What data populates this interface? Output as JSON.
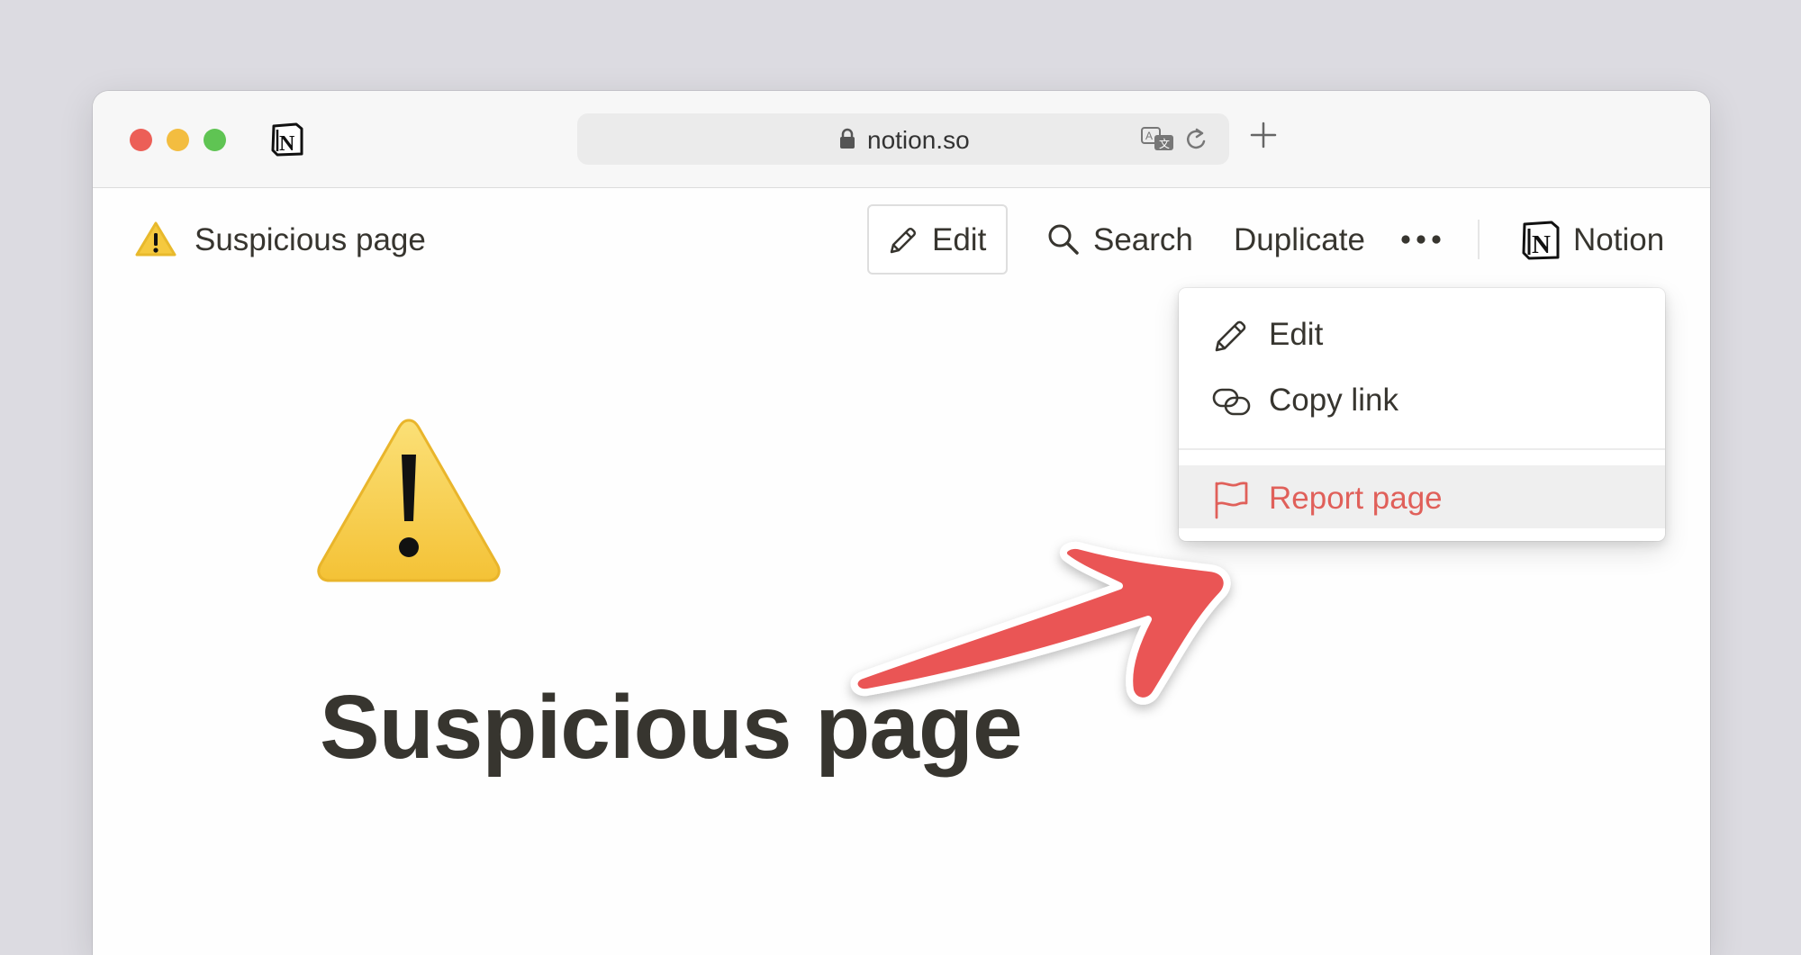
{
  "browser": {
    "url": "notion.so"
  },
  "topbar": {
    "breadcrumb": "Suspicious page",
    "edit_label": "Edit",
    "search_label": "Search",
    "duplicate_label": "Duplicate",
    "brand_label": "Notion"
  },
  "menu": {
    "items": [
      {
        "label": "Edit",
        "icon": "pencil-icon"
      },
      {
        "label": "Copy link",
        "icon": "link-icon"
      },
      {
        "label": "Report page",
        "icon": "flag-icon",
        "color": "#e0605a",
        "highlighted": true
      }
    ]
  },
  "page": {
    "icon": "warning-icon",
    "title": "Suspicious page"
  },
  "annotation": {
    "arrow_color": "#ea5454"
  }
}
